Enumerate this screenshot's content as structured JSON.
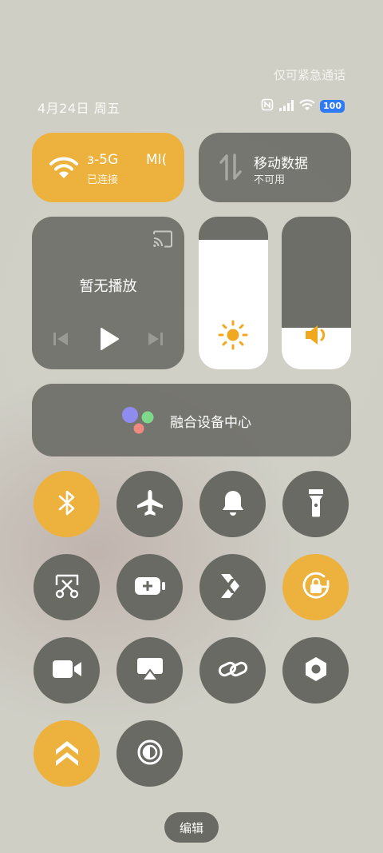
{
  "status_bar": {
    "emergency_text": "仅可紧急通话",
    "date_text": "4月24日 周五",
    "battery_level": "100",
    "icons": [
      "nfc-icon",
      "signal-icon",
      "wifi-icon",
      "battery-icon"
    ]
  },
  "wifi_tile": {
    "title": "ɜ-5G",
    "title_extra": "MI(",
    "subtitle": "已连接",
    "icon": "wifi-icon",
    "state": "on"
  },
  "mobile_tile": {
    "title": "移动数据",
    "subtitle": "不可用",
    "icon": "data-arrows-icon",
    "state": "off"
  },
  "media": {
    "title": "暂无播放",
    "icons": [
      "cast-icon",
      "previous-icon",
      "play-icon",
      "next-icon"
    ]
  },
  "brightness": {
    "level": 0.85,
    "icon": "sun-icon"
  },
  "volume": {
    "level": 0.27,
    "icon": "speaker-icon"
  },
  "device_center": {
    "label": "融合设备中心",
    "icon": "device-center-icon"
  },
  "toggles": [
    {
      "name": "bluetooth",
      "icon": "bluetooth-icon",
      "on": true
    },
    {
      "name": "airplane",
      "icon": "airplane-icon",
      "on": false
    },
    {
      "name": "bell",
      "icon": "bell-icon",
      "on": false
    },
    {
      "name": "flashlight",
      "icon": "flashlight-icon",
      "on": false
    },
    {
      "name": "screenshot",
      "icon": "screenshot-icon",
      "on": false
    },
    {
      "name": "battery-saver",
      "icon": "battery-saver-icon",
      "on": false
    },
    {
      "name": "link-share",
      "icon": "share-arrow-icon",
      "on": false
    },
    {
      "name": "rotation-lock",
      "icon": "rotation-lock-icon",
      "on": true
    },
    {
      "name": "screen-record",
      "icon": "video-camera-icon",
      "on": false
    },
    {
      "name": "screen-cast",
      "icon": "airplay-icon",
      "on": false
    },
    {
      "name": "link",
      "icon": "link-icon",
      "on": false
    },
    {
      "name": "settings",
      "icon": "hexagon-icon",
      "on": false
    },
    {
      "name": "performance",
      "icon": "double-chevron-up-icon",
      "on": true
    },
    {
      "name": "dark-mode",
      "icon": "contrast-icon",
      "on": false
    }
  ],
  "edit_label": "编辑",
  "colors": {
    "accent": "#edb23d",
    "tile": "#6a6a65",
    "battery": "#2f7bf5"
  }
}
